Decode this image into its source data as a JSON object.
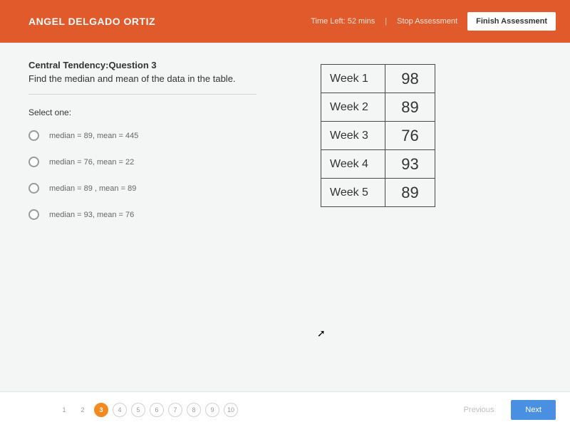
{
  "header": {
    "student_name": "ANGEL DELGADO ORTIZ",
    "time_left_label": "Time Left: ",
    "time_left_value": "52 mins",
    "stop_label": "Stop Assessment",
    "finish_label": "Finish Assessment"
  },
  "question": {
    "title": "Central Tendency:Question 3",
    "prompt": "Find the median and mean of the data in the table.",
    "select_one": "Select one:",
    "options": [
      "median = 89, mean = 445",
      "median = 76, mean = 22",
      "median = 89 , mean = 89",
      "median = 93, mean = 76"
    ]
  },
  "table": {
    "rows": [
      {
        "label": "Week 1",
        "value": "98"
      },
      {
        "label": "Week 2",
        "value": "89"
      },
      {
        "label": "Week 3",
        "value": "76"
      },
      {
        "label": "Week 4",
        "value": "93"
      },
      {
        "label": "Week 5",
        "value": "89"
      }
    ]
  },
  "pager": {
    "items": [
      "1",
      "2",
      "3",
      "4",
      "5",
      "6",
      "7",
      "8",
      "9",
      "10"
    ],
    "active_index": 2,
    "prev": "Previous",
    "next": "Next"
  },
  "colors": {
    "header_bg": "#e05a2b",
    "next_btn": "#4a90e2",
    "active_page": "#f28a1f"
  }
}
